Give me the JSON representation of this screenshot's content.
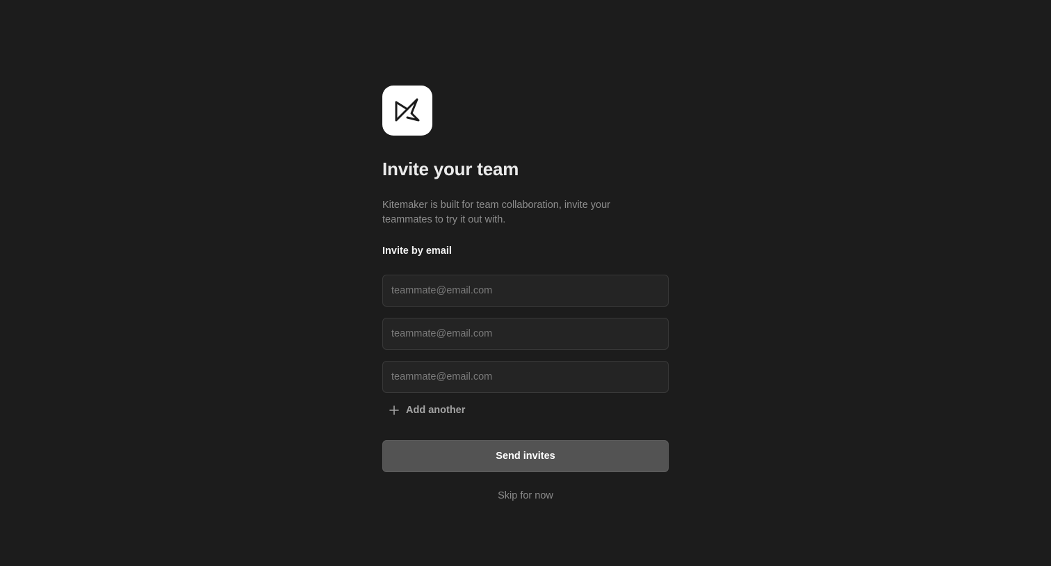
{
  "logo": {
    "icon": "kitemaker-logo-icon",
    "background": "#ffffff"
  },
  "heading": "Invite your team",
  "description": "Kitemaker is built for team collaboration, invite your teammates to try it out with.",
  "invite_section": {
    "label": "Invite by email",
    "inputs": [
      {
        "value": "",
        "placeholder": "teammate@email.com"
      },
      {
        "value": "",
        "placeholder": "teammate@email.com"
      },
      {
        "value": "",
        "placeholder": "teammate@email.com"
      }
    ],
    "add_another": {
      "icon": "plus-icon",
      "label": "Add another"
    }
  },
  "actions": {
    "send_label": "Send invites",
    "skip_label": "Skip for now"
  },
  "colors": {
    "background": "#1c1c1c",
    "input_background": "#242424",
    "button_background": "#535353"
  }
}
